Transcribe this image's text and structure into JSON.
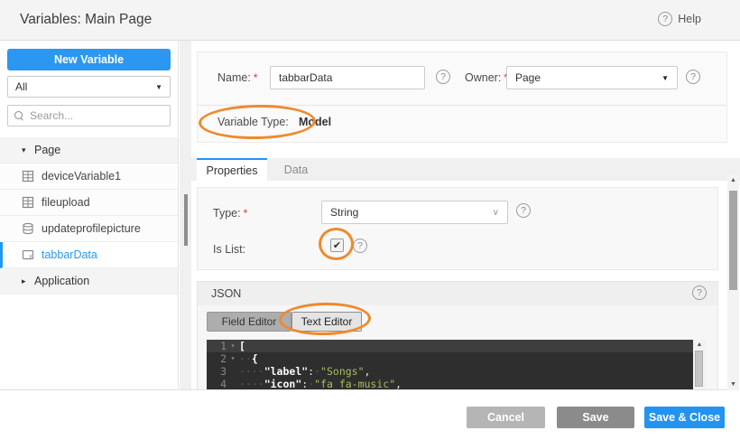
{
  "header": {
    "title": "Variables: Main Page",
    "help_label": "Help"
  },
  "icons": {
    "help": "?",
    "caret_down": "▾",
    "caret_right": "▸",
    "select_caret": "▼",
    "chevron_down": "∨",
    "check": "✔",
    "scroll_up": "▲",
    "scroll_down": "▼"
  },
  "colors": {
    "accent_blue": "#2196f3",
    "annotation_orange": "#ee8a2c",
    "editor_background": "#2e2e2e",
    "editor_string": "#a3bf5f"
  },
  "sidebar": {
    "new_variable_label": "New Variable",
    "filter_value": "All",
    "search_placeholder": "Search...",
    "tree": [
      {
        "label": "Page",
        "type": "group",
        "expanded": true
      },
      {
        "label": "deviceVariable1",
        "type": "device-variable"
      },
      {
        "label": "fileupload",
        "type": "device-variable"
      },
      {
        "label": "updateprofilepicture",
        "type": "service-variable"
      },
      {
        "label": "tabbarData",
        "type": "model-variable",
        "selected": true
      },
      {
        "label": "Application",
        "type": "group",
        "expanded": false
      }
    ]
  },
  "form": {
    "required_mark": "*",
    "name_label": "Name:",
    "name_value": "tabbarData",
    "owner_label": "Owner:",
    "owner_value": "Page",
    "variable_type_label": "Variable Type:",
    "variable_type_value": "Model"
  },
  "tabs": {
    "properties_label": "Properties",
    "data_label": "Data",
    "active": "Properties"
  },
  "properties": {
    "type_label": "Type:",
    "type_value": "String",
    "is_list_label": "Is List:",
    "is_list_checked": true
  },
  "json_section": {
    "title": "JSON",
    "field_editor_label": "Field Editor",
    "text_editor_label": "Text Editor",
    "selected_editor": "Text Editor"
  },
  "code": {
    "lines": [
      {
        "num": "1",
        "fold": "▾",
        "segments": [
          {
            "t": "["
          }
        ]
      },
      {
        "num": "2",
        "fold": "▾",
        "segments": [
          {
            "t": "··"
          },
          {
            "t": "{"
          }
        ]
      },
      {
        "num": "3",
        "fold": "",
        "segments": [
          {
            "t": "····"
          },
          {
            "t": "\"label\""
          },
          {
            "t": ":"
          },
          {
            "t": "·"
          },
          {
            "t": "\"Songs\""
          },
          {
            "t": ","
          }
        ]
      },
      {
        "num": "4",
        "fold": "",
        "segments": [
          {
            "t": "····"
          },
          {
            "t": "\"icon\""
          },
          {
            "t": ":"
          },
          {
            "t": "·"
          },
          {
            "t": "\"fa fa-music\""
          },
          {
            "t": ","
          }
        ]
      }
    ]
  },
  "footer": {
    "cancel_label": "Cancel",
    "save_label": "Save",
    "save_close_label": "Save & Close"
  }
}
